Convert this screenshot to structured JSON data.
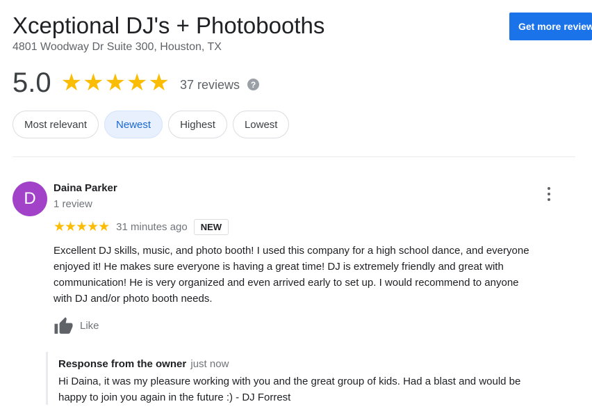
{
  "business": {
    "name": "Xceptional DJ's + Photobooths",
    "address": "4801 Woodway Dr Suite 300, Houston, TX"
  },
  "actions": {
    "get_more_reviews": "Get more reviews"
  },
  "rating": {
    "value": "5.0",
    "stars": "★★★★★",
    "stars_count": 5,
    "review_count": "37 reviews",
    "help_icon": "question-circle-icon"
  },
  "sort": {
    "options": [
      "Most relevant",
      "Newest",
      "Highest",
      "Lowest"
    ],
    "selected": "Newest"
  },
  "review": {
    "avatar_initial": "D",
    "avatar_color": "#a142c8",
    "name": "Daina Parker",
    "meta": "1 review",
    "stars": "★★★★★",
    "stars_count": 5,
    "time": "31 minutes ago",
    "badge": "NEW",
    "text_lines": [
      "Excellent DJ skills, music, and photo booth! I used this company for a high school dance, and everyone",
      "enjoyed it! He makes sure everyone is having a great time!  DJ is extremely friendly and great with",
      "communication!   He is very organized and even arrived early to set up.  I would recommend to anyone",
      "with DJ and/or photo booth needs."
    ],
    "like_label": "Like",
    "like_icon": "thumbs-up-icon",
    "more_icon": "more-vert-icon"
  },
  "owner_response": {
    "label": "Response from the owner",
    "time": "just now",
    "text_lines": [
      "Hi Daina, it was my pleasure working with you and the great group of kids. Had a blast and would be",
      "happy to join you again in the future :) - DJ Forrest"
    ]
  },
  "colors": {
    "accent": "#1a73e8",
    "star": "#fbbc04",
    "chip_selected_bg": "#e8f0fe",
    "chip_selected_text": "#1967d2"
  }
}
